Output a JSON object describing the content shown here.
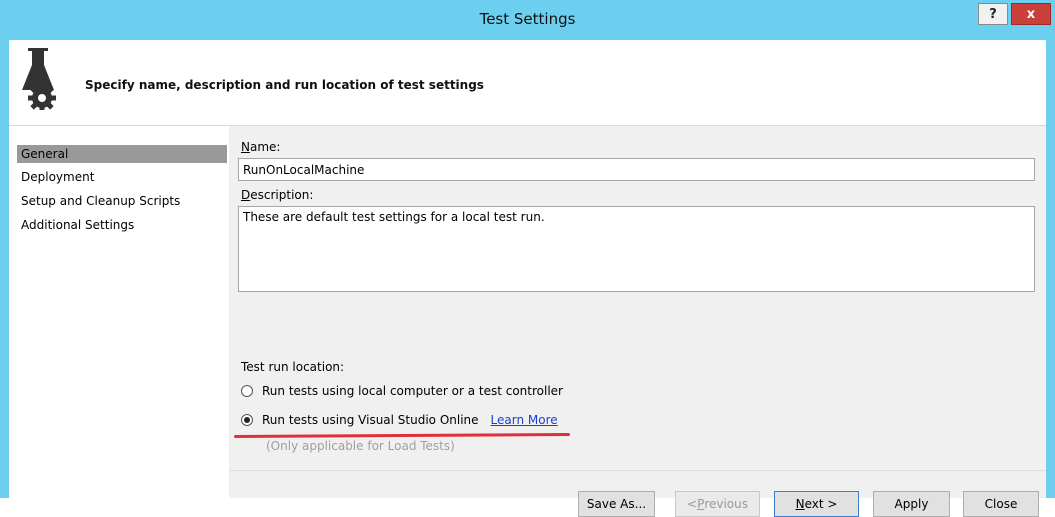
{
  "window": {
    "title": "Test Settings",
    "help_label": "?",
    "close_label": "x"
  },
  "header": {
    "description": "Specify name, description and run location of test settings"
  },
  "sidebar": {
    "items": [
      {
        "label": "General",
        "selected": true
      },
      {
        "label": "Deployment",
        "selected": false
      },
      {
        "label": "Setup and Cleanup Scripts",
        "selected": false
      },
      {
        "label": "Additional Settings",
        "selected": false
      }
    ]
  },
  "form": {
    "name_label_accel": "N",
    "name_label_rest": "ame:",
    "name_value": "RunOnLocalMachine",
    "description_label_accel": "D",
    "description_label_rest": "escription:",
    "description_value": "These are default test settings for a local test run.",
    "run_location_label": "Test run location:",
    "options": [
      {
        "label": "Run tests using local computer or a test controller",
        "checked": false
      },
      {
        "label": "Run tests using Visual Studio Online",
        "checked": true
      }
    ],
    "learn_more": "Learn More",
    "hint": "(Only applicable for Load Tests)"
  },
  "buttons": {
    "save_as": "Save As...",
    "previous_prefix": "< ",
    "previous_accel": "P",
    "previous_rest": "revious",
    "next_accel": "N",
    "next_rest": "ext >",
    "apply": "Apply",
    "close": "Close"
  },
  "colors": {
    "title_bar": "#6dcff0",
    "selection": "#999999",
    "annotation_underline": "#e0303a",
    "link": "#1a3fd6"
  }
}
